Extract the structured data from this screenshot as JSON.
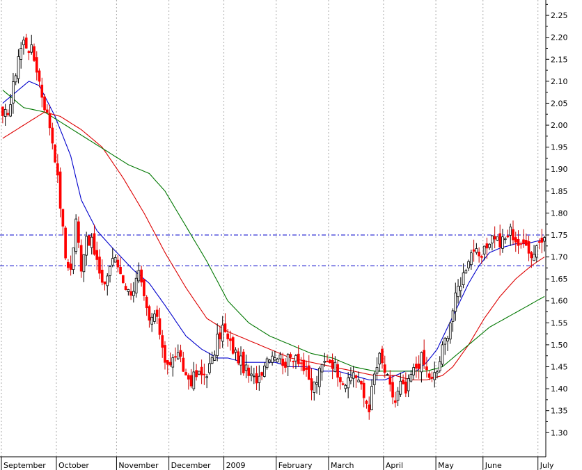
{
  "chart_data": {
    "type": "candlestick",
    "y_axis_side": "right",
    "ylim": [
      1.245,
      2.285
    ],
    "grid": "vertical dotted lines at month starts",
    "y_ticks": [
      "1.30",
      "1.35",
      "1.40",
      "1.45",
      "1.50",
      "1.55",
      "1.60",
      "1.65",
      "1.70",
      "1.75",
      "1.80",
      "1.85",
      "1.90",
      "1.95",
      "2.00",
      "2.05",
      "2.10",
      "2.15",
      "2.20",
      "2.25"
    ],
    "x_ticks": [
      {
        "label": "September",
        "index": 0
      },
      {
        "label": "October",
        "index": 21
      },
      {
        "label": "November",
        "index": 44
      },
      {
        "label": "December",
        "index": 64
      },
      {
        "label": "2009",
        "index": 85
      },
      {
        "label": "February",
        "index": 105
      },
      {
        "label": "March",
        "index": 125
      },
      {
        "label": "April",
        "index": 146
      },
      {
        "label": "May",
        "index": 166
      },
      {
        "label": "June",
        "index": 184
      },
      {
        "label": "July",
        "index": 205
      }
    ],
    "n_bars": 208,
    "close_anchors": [
      [
        0,
        2.01
      ],
      [
        3,
        2.05
      ],
      [
        6,
        2.16
      ],
      [
        8,
        2.19
      ],
      [
        11,
        2.17
      ],
      [
        13,
        2.13
      ],
      [
        15,
        2.07
      ],
      [
        18,
        2.0
      ],
      [
        20,
        1.93
      ],
      [
        22,
        1.82
      ],
      [
        24,
        1.7
      ],
      [
        26,
        1.67
      ],
      [
        28,
        1.78
      ],
      [
        30,
        1.68
      ],
      [
        32,
        1.75
      ],
      [
        34,
        1.73
      ],
      [
        36,
        1.69
      ],
      [
        38,
        1.63
      ],
      [
        40,
        1.66
      ],
      [
        42,
        1.7
      ],
      [
        44,
        1.68
      ],
      [
        46,
        1.65
      ],
      [
        48,
        1.62
      ],
      [
        50,
        1.63
      ],
      [
        52,
        1.66
      ],
      [
        54,
        1.6
      ],
      [
        56,
        1.55
      ],
      [
        58,
        1.57
      ],
      [
        60,
        1.53
      ],
      [
        62,
        1.47
      ],
      [
        64,
        1.45
      ],
      [
        66,
        1.48
      ],
      [
        68,
        1.46
      ],
      [
        70,
        1.43
      ],
      [
        72,
        1.42
      ],
      [
        74,
        1.43
      ],
      [
        76,
        1.43
      ],
      [
        78,
        1.44
      ],
      [
        80,
        1.46
      ],
      [
        82,
        1.51
      ],
      [
        84,
        1.54
      ],
      [
        86,
        1.51
      ],
      [
        88,
        1.49
      ],
      [
        90,
        1.47
      ],
      [
        92,
        1.45
      ],
      [
        94,
        1.43
      ],
      [
        96,
        1.42
      ],
      [
        98,
        1.43
      ],
      [
        100,
        1.46
      ],
      [
        102,
        1.48
      ],
      [
        104,
        1.48
      ],
      [
        106,
        1.47
      ],
      [
        108,
        1.46
      ],
      [
        110,
        1.47
      ],
      [
        112,
        1.48
      ],
      [
        114,
        1.46
      ],
      [
        116,
        1.43
      ],
      [
        118,
        1.4
      ],
      [
        120,
        1.42
      ],
      [
        122,
        1.45
      ],
      [
        124,
        1.47
      ],
      [
        126,
        1.46
      ],
      [
        128,
        1.44
      ],
      [
        130,
        1.42
      ],
      [
        132,
        1.41
      ],
      [
        134,
        1.44
      ],
      [
        136,
        1.42
      ],
      [
        138,
        1.38
      ],
      [
        140,
        1.36
      ],
      [
        142,
        1.43
      ],
      [
        144,
        1.47
      ],
      [
        146,
        1.44
      ],
      [
        148,
        1.4
      ],
      [
        150,
        1.37
      ],
      [
        152,
        1.41
      ],
      [
        154,
        1.39
      ],
      [
        156,
        1.43
      ],
      [
        158,
        1.45
      ],
      [
        160,
        1.47
      ],
      [
        162,
        1.44
      ],
      [
        164,
        1.42
      ],
      [
        166,
        1.44
      ],
      [
        168,
        1.49
      ],
      [
        170,
        1.53
      ],
      [
        172,
        1.58
      ],
      [
        174,
        1.63
      ],
      [
        176,
        1.66
      ],
      [
        178,
        1.7
      ],
      [
        180,
        1.72
      ],
      [
        182,
        1.69
      ],
      [
        184,
        1.71
      ],
      [
        186,
        1.74
      ],
      [
        188,
        1.75
      ],
      [
        190,
        1.73
      ],
      [
        192,
        1.74
      ],
      [
        194,
        1.76
      ],
      [
        196,
        1.74
      ],
      [
        198,
        1.72
      ],
      [
        200,
        1.74
      ],
      [
        202,
        1.7
      ],
      [
        204,
        1.73
      ],
      [
        206,
        1.74
      ],
      [
        207,
        1.73
      ]
    ],
    "series": [
      {
        "label": "blue moving average",
        "color": "#0000cc",
        "points": [
          [
            0,
            2.05
          ],
          [
            10,
            2.1
          ],
          [
            14,
            2.09
          ],
          [
            20,
            2.02
          ],
          [
            26,
            1.93
          ],
          [
            30,
            1.83
          ],
          [
            36,
            1.76
          ],
          [
            42,
            1.72
          ],
          [
            50,
            1.67
          ],
          [
            56,
            1.64
          ],
          [
            62,
            1.59
          ],
          [
            70,
            1.52
          ],
          [
            76,
            1.49
          ],
          [
            82,
            1.47
          ],
          [
            86,
            1.47
          ],
          [
            92,
            1.46
          ],
          [
            98,
            1.46
          ],
          [
            104,
            1.46
          ],
          [
            110,
            1.45
          ],
          [
            116,
            1.45
          ],
          [
            122,
            1.44
          ],
          [
            128,
            1.44
          ],
          [
            134,
            1.43
          ],
          [
            140,
            1.42
          ],
          [
            146,
            1.42
          ],
          [
            150,
            1.43
          ],
          [
            154,
            1.44
          ],
          [
            158,
            1.44
          ],
          [
            162,
            1.46
          ],
          [
            166,
            1.49
          ],
          [
            170,
            1.54
          ],
          [
            174,
            1.59
          ],
          [
            178,
            1.64
          ],
          [
            182,
            1.68
          ],
          [
            186,
            1.71
          ],
          [
            190,
            1.72
          ],
          [
            196,
            1.73
          ],
          [
            200,
            1.73
          ],
          [
            207,
            1.74
          ]
        ]
      },
      {
        "label": "red moving average",
        "color": "#dd0000",
        "points": [
          [
            0,
            1.97
          ],
          [
            8,
            2.0
          ],
          [
            16,
            2.03
          ],
          [
            22,
            2.02
          ],
          [
            30,
            1.99
          ],
          [
            38,
            1.95
          ],
          [
            46,
            1.88
          ],
          [
            54,
            1.8
          ],
          [
            62,
            1.71
          ],
          [
            70,
            1.63
          ],
          [
            78,
            1.56
          ],
          [
            86,
            1.53
          ],
          [
            94,
            1.51
          ],
          [
            102,
            1.49
          ],
          [
            110,
            1.47
          ],
          [
            118,
            1.46
          ],
          [
            126,
            1.45
          ],
          [
            134,
            1.44
          ],
          [
            142,
            1.43
          ],
          [
            150,
            1.43
          ],
          [
            156,
            1.42
          ],
          [
            162,
            1.42
          ],
          [
            168,
            1.43
          ],
          [
            172,
            1.45
          ],
          [
            178,
            1.5
          ],
          [
            184,
            1.56
          ],
          [
            190,
            1.61
          ],
          [
            196,
            1.65
          ],
          [
            202,
            1.68
          ],
          [
            207,
            1.7
          ]
        ]
      },
      {
        "label": "green moving average",
        "color": "#007700",
        "points": [
          [
            0,
            2.08
          ],
          [
            8,
            2.04
          ],
          [
            16,
            2.03
          ],
          [
            24,
            2.0
          ],
          [
            32,
            1.97
          ],
          [
            40,
            1.94
          ],
          [
            48,
            1.91
          ],
          [
            56,
            1.89
          ],
          [
            62,
            1.85
          ],
          [
            70,
            1.77
          ],
          [
            78,
            1.69
          ],
          [
            86,
            1.6
          ],
          [
            94,
            1.55
          ],
          [
            102,
            1.52
          ],
          [
            110,
            1.5
          ],
          [
            118,
            1.48
          ],
          [
            126,
            1.47
          ],
          [
            134,
            1.45
          ],
          [
            142,
            1.44
          ],
          [
            150,
            1.44
          ],
          [
            156,
            1.44
          ],
          [
            162,
            1.44
          ],
          [
            168,
            1.45
          ],
          [
            174,
            1.48
          ],
          [
            180,
            1.51
          ],
          [
            186,
            1.54
          ],
          [
            192,
            1.56
          ],
          [
            198,
            1.58
          ],
          [
            204,
            1.6
          ],
          [
            207,
            1.61
          ]
        ]
      }
    ],
    "reference_lines": [
      {
        "value": 1.75,
        "style": "dash-dot",
        "color": "#0000cc"
      },
      {
        "value": 1.68,
        "style": "dash-dot",
        "color": "#0000cc"
      }
    ],
    "colors": {
      "up_candle": "#000000",
      "down_candle": "#ff0000",
      "background": "#ffffff",
      "grid": "#aaaaaa"
    }
  }
}
